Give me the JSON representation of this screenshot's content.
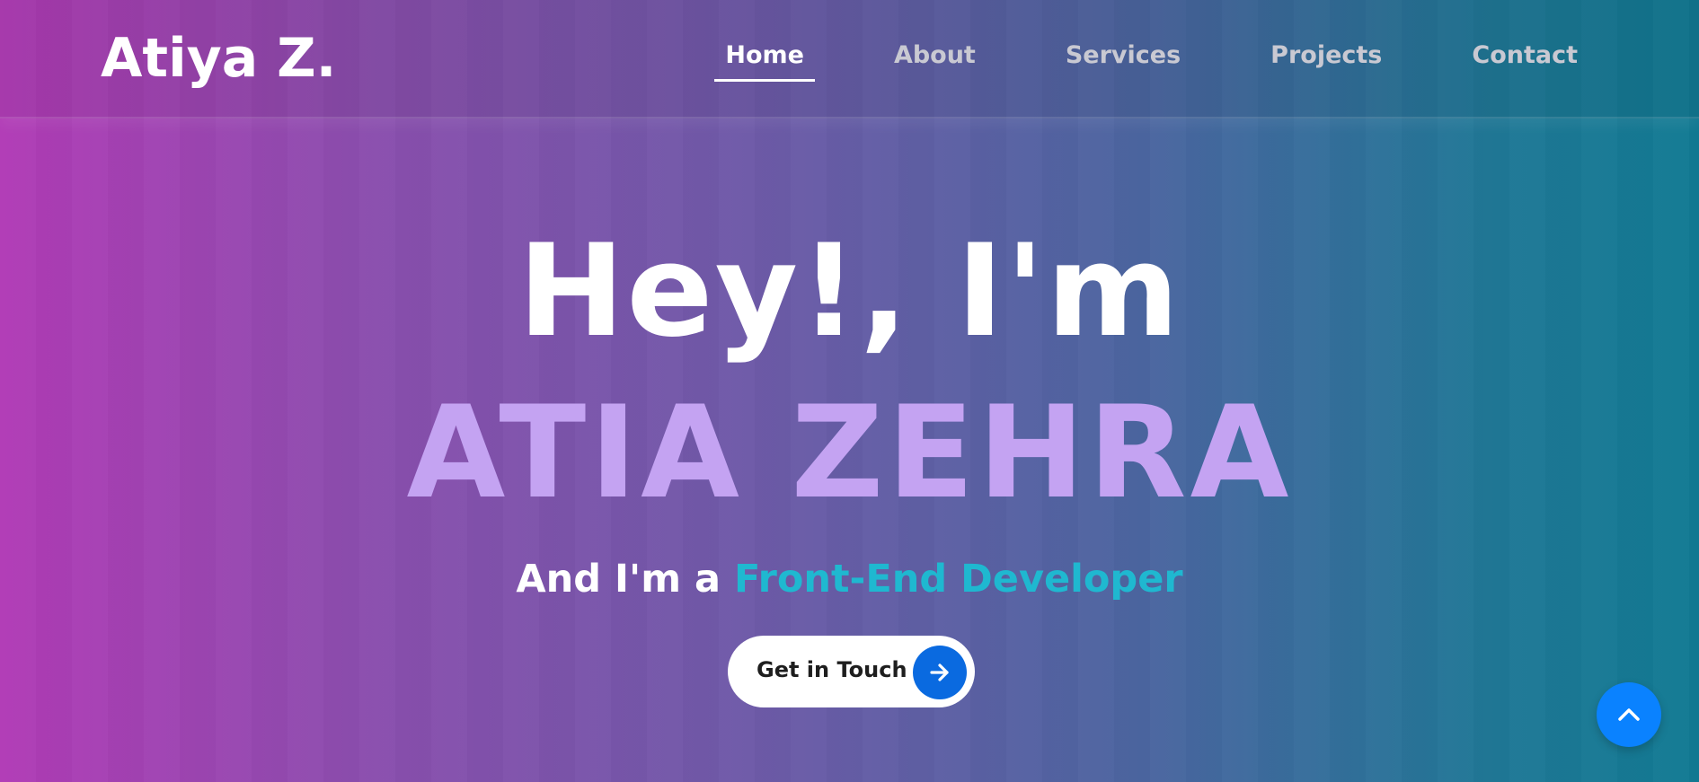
{
  "header": {
    "logo": "Atiya Z.",
    "nav": [
      {
        "label": "Home",
        "active": true
      },
      {
        "label": "About",
        "active": false
      },
      {
        "label": "Services",
        "active": false
      },
      {
        "label": "Projects",
        "active": false
      },
      {
        "label": "Contact",
        "active": false
      }
    ]
  },
  "hero": {
    "greeting": "Hey!, I'm",
    "name": "ATIA ZEHRA",
    "subtitle_prefix": "And I'm a ",
    "subtitle_role": "Front-End Developer",
    "cta_label": "Get in Touch",
    "cta_icon": "arrow-right-icon"
  },
  "floating": {
    "scroll_top_icon": "chevron-up-icon"
  },
  "colors": {
    "gradient_start": "#b13bb6",
    "gradient_end": "#117a93",
    "name_color": "#c4a3f2",
    "role_color": "#1fb8d0",
    "cta_circle": "#0a6ae0",
    "scroll_top": "#0a82ff"
  }
}
